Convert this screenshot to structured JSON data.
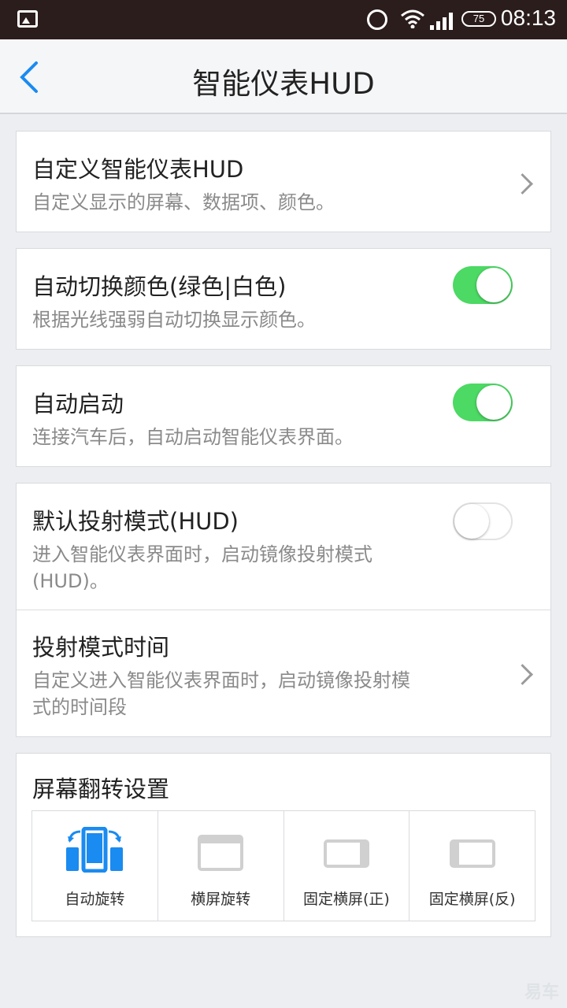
{
  "status_bar": {
    "time": "08:13",
    "battery": "75"
  },
  "header": {
    "title": "智能仪表HUD"
  },
  "settings": {
    "customize": {
      "title": "自定义智能仪表HUD",
      "subtitle": "自定义显示的屏幕、数据项、颜色。"
    },
    "auto_color": {
      "title": "自动切换颜色(绿色|白色)",
      "subtitle": "根据光线强弱自动切换显示颜色。",
      "enabled": true
    },
    "auto_start": {
      "title": "自动启动",
      "subtitle": "连接汽车后，自动启动智能仪表界面。",
      "enabled": true
    },
    "projection_mode": {
      "title": "默认投射模式(HUD)",
      "subtitle_line1": "进入智能仪表界面时，启动镜像投射模式",
      "subtitle_line2": "(HUD)。",
      "enabled": false
    },
    "projection_time": {
      "title": "投射模式时间",
      "subtitle_line1": "自定义进入智能仪表界面时，启动镜像投射模",
      "subtitle_line2": "式的时间段"
    }
  },
  "rotation": {
    "title": "屏幕翻转设置",
    "options": [
      {
        "label": "自动旋转",
        "selected": true
      },
      {
        "label": "横屏旋转",
        "selected": false
      },
      {
        "label": "固定横屏(正)",
        "selected": false
      },
      {
        "label": "固定横屏(反)",
        "selected": false
      }
    ]
  },
  "colors": {
    "accent": "#1a8bf0",
    "toggle_on": "#4cd964"
  },
  "watermark": "易车"
}
